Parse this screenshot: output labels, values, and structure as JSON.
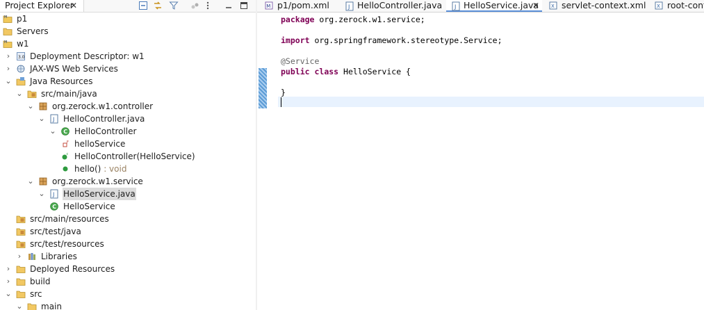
{
  "explorer": {
    "title": "Project Explorer",
    "close": "✕",
    "tree": [
      {
        "label": "p1",
        "icon": "maven-project-icon",
        "chev": "",
        "selected": false
      },
      {
        "label": "Servers",
        "icon": "folder-icon",
        "chev": "",
        "selected": false
      },
      {
        "label": "w1",
        "icon": "maven-project-icon",
        "chev": "",
        "selected": false
      },
      {
        "label": "Deployment Descriptor: w1",
        "icon": "deployment-descriptor-icon",
        "chev": "›",
        "selected": false
      },
      {
        "label": "JAX-WS Web Services",
        "icon": "web-services-icon",
        "chev": "›",
        "selected": false
      },
      {
        "label": "Java Resources",
        "icon": "java-resources-icon",
        "chev": "⌄",
        "selected": false
      },
      {
        "label": "src/main/java",
        "icon": "source-folder-icon",
        "chev": "⌄",
        "selected": false
      },
      {
        "label": "org.zerock.w1.controller",
        "icon": "package-icon",
        "chev": "⌄",
        "selected": false
      },
      {
        "label": "HelloController.java",
        "icon": "java-file-icon",
        "chev": "⌄",
        "selected": false
      },
      {
        "label": "HelloController",
        "icon": "class-icon",
        "chev": "⌄",
        "selected": false
      },
      {
        "label": "helloService",
        "icon": "field-icon",
        "chev": "",
        "selected": false
      },
      {
        "label": "HelloController(HelloService)",
        "icon": "constructor-icon",
        "chev": "",
        "selected": false
      },
      {
        "label": "hello()",
        "deco": " : void",
        "icon": "method-icon",
        "chev": "",
        "selected": false
      },
      {
        "label": "org.zerock.w1.service",
        "icon": "package-icon",
        "chev": "⌄",
        "selected": false
      },
      {
        "label": "HelloService.java",
        "icon": "java-file-icon",
        "chev": "⌄",
        "selected": true
      },
      {
        "label": "HelloService",
        "icon": "class-icon",
        "chev": "",
        "selected": false
      },
      {
        "label": "src/main/resources",
        "icon": "source-folder-icon",
        "chev": "",
        "selected": false
      },
      {
        "label": "src/test/java",
        "icon": "source-folder-icon",
        "chev": "",
        "selected": false
      },
      {
        "label": "src/test/resources",
        "icon": "source-folder-icon",
        "chev": "",
        "selected": false
      },
      {
        "label": "Libraries",
        "icon": "libraries-icon",
        "chev": "›",
        "selected": false
      },
      {
        "label": "Deployed Resources",
        "icon": "folder-icon",
        "chev": "›",
        "selected": false
      },
      {
        "label": "build",
        "icon": "folder-icon",
        "chev": "›",
        "selected": false
      },
      {
        "label": "src",
        "icon": "folder-icon",
        "chev": "⌄",
        "selected": false
      },
      {
        "label": "main",
        "icon": "folder-icon",
        "chev": "⌄",
        "selected": false
      }
    ]
  },
  "editor": {
    "tabs": [
      {
        "label": "p1/pom.xml",
        "icon": "maven-file-icon",
        "active": false
      },
      {
        "label": "HelloController.java",
        "icon": "java-file-icon",
        "active": false
      },
      {
        "label": "HelloService.java",
        "icon": "java-file-icon",
        "active": true,
        "close": "✕"
      },
      {
        "label": "servlet-context.xml",
        "icon": "xml-file-icon",
        "active": false
      },
      {
        "label": "root-conte",
        "icon": "xml-file-icon",
        "active": false
      }
    ],
    "code": [
      [
        {
          "t": "package",
          "c": "kw"
        },
        {
          "t": " org.zerock.w1.service;",
          "c": ""
        }
      ],
      [],
      [
        {
          "t": "import",
          "c": "kw"
        },
        {
          "t": " org.springframework.stereotype.Service;",
          "c": ""
        }
      ],
      [],
      [
        {
          "t": "@Service",
          "c": "ann"
        }
      ],
      [
        {
          "t": "public",
          "c": "kw"
        },
        {
          "t": " ",
          "c": ""
        },
        {
          "t": "class",
          "c": "kw"
        },
        {
          "t": " HelloService {",
          "c": ""
        }
      ],
      [],
      [
        {
          "t": "}",
          "c": ""
        }
      ],
      []
    ]
  },
  "colors": {
    "keyword": "#7f0055",
    "annotation": "#646464",
    "current_line": "#e8f2fe",
    "active_tab_underline": "#5a8fd8",
    "change_bar": "#5b9bd5"
  }
}
